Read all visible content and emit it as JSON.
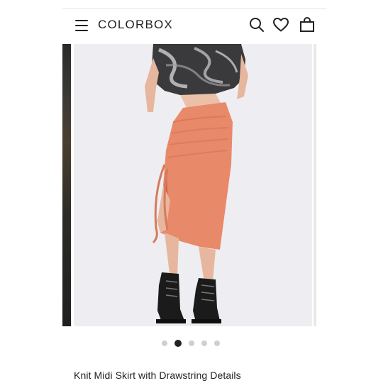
{
  "header": {
    "brand": "COLORBOX",
    "icons": [
      "menu-icon",
      "search-icon",
      "heart-icon",
      "bag-icon"
    ]
  },
  "gallery": {
    "slide_count": 5,
    "active_slide": 2,
    "dots": [
      "slide 1",
      "slide 2",
      "slide 3",
      "slide 4",
      "slide 5"
    ]
  },
  "product": {
    "title": "Knit Midi Skirt with Drawstring Details",
    "color": "#e8896a"
  },
  "colors": {
    "background": "#ffffff",
    "photo_background": "#eeeef2",
    "dot_active": "#222222",
    "dot_inactive": "#cfcfcf"
  }
}
